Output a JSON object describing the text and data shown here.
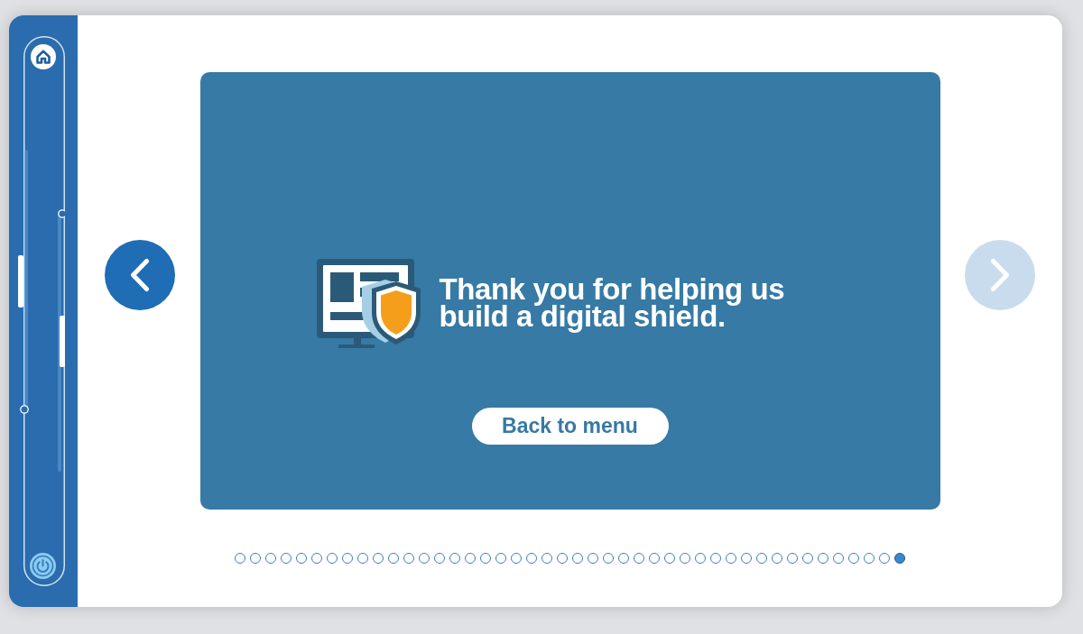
{
  "navigation": {
    "previous": {
      "disabled": false
    },
    "next": {
      "disabled": true
    }
  },
  "slide": {
    "message": "Thank you for helping us build a digital shield.",
    "button": "Back to menu"
  },
  "pagination": [
    {
      "selected": false
    },
    {
      "selected": false
    },
    {
      "selected": false
    },
    {
      "selected": false
    },
    {
      "selected": false
    },
    {
      "selected": false
    },
    {
      "selected": false
    },
    {
      "selected": false
    },
    {
      "selected": false
    },
    {
      "selected": false
    },
    {
      "selected": false
    },
    {
      "selected": false
    },
    {
      "selected": false
    },
    {
      "selected": false
    },
    {
      "selected": false
    },
    {
      "selected": false
    },
    {
      "selected": false
    },
    {
      "selected": false
    },
    {
      "selected": false
    },
    {
      "selected": false
    },
    {
      "selected": false
    },
    {
      "selected": false
    },
    {
      "selected": false
    },
    {
      "selected": false
    },
    {
      "selected": false
    },
    {
      "selected": false
    },
    {
      "selected": false
    },
    {
      "selected": false
    },
    {
      "selected": false
    },
    {
      "selected": false
    },
    {
      "selected": false
    },
    {
      "selected": false
    },
    {
      "selected": false
    },
    {
      "selected": false
    },
    {
      "selected": false
    },
    {
      "selected": false
    },
    {
      "selected": false
    },
    {
      "selected": false
    },
    {
      "selected": false
    },
    {
      "selected": false
    },
    {
      "selected": false
    },
    {
      "selected": false
    },
    {
      "selected": false
    },
    {
      "selected": true
    }
  ]
}
